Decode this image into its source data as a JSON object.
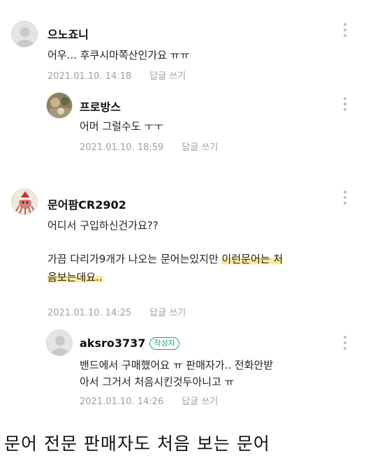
{
  "comments": [
    {
      "nick": "으노죠니",
      "text": "어우... 후쿠시마쪽산인가요 ㅠㅠ",
      "date": "2021.01.10. 14:18",
      "reply_label": "답글 쓰기"
    },
    {
      "nick": "프로방스",
      "text": "어머 그럴수도 ㅜㅜ",
      "date": "2021.01.10. 18:59",
      "reply_label": "답글 쓰기"
    },
    {
      "nick": "문어팜CR2902",
      "line1": "어디서 구입하신건가요??",
      "line2a": "가끔 다리가9개가 나오는 문어는있지만 ",
      "line2b": "이런문어는 처",
      "line3": "음보는데요..",
      "date": "2021.01.10. 14:25",
      "reply_label": "답글 쓰기"
    },
    {
      "nick": "aksro3737",
      "badge": "작성자",
      "line1": "밴드에서 구매했어요 ㅠ 판매자가.. 전화안받",
      "line2": "아서 그거서 처음시킨것두아니고 ㅠ",
      "date": "2021.01.10. 14:26",
      "reply_label": "답글 쓰기"
    }
  ],
  "caption": "문어 전문 판매자도 처음 보는 문어",
  "icons": {
    "more": "more-vertical-icon"
  }
}
